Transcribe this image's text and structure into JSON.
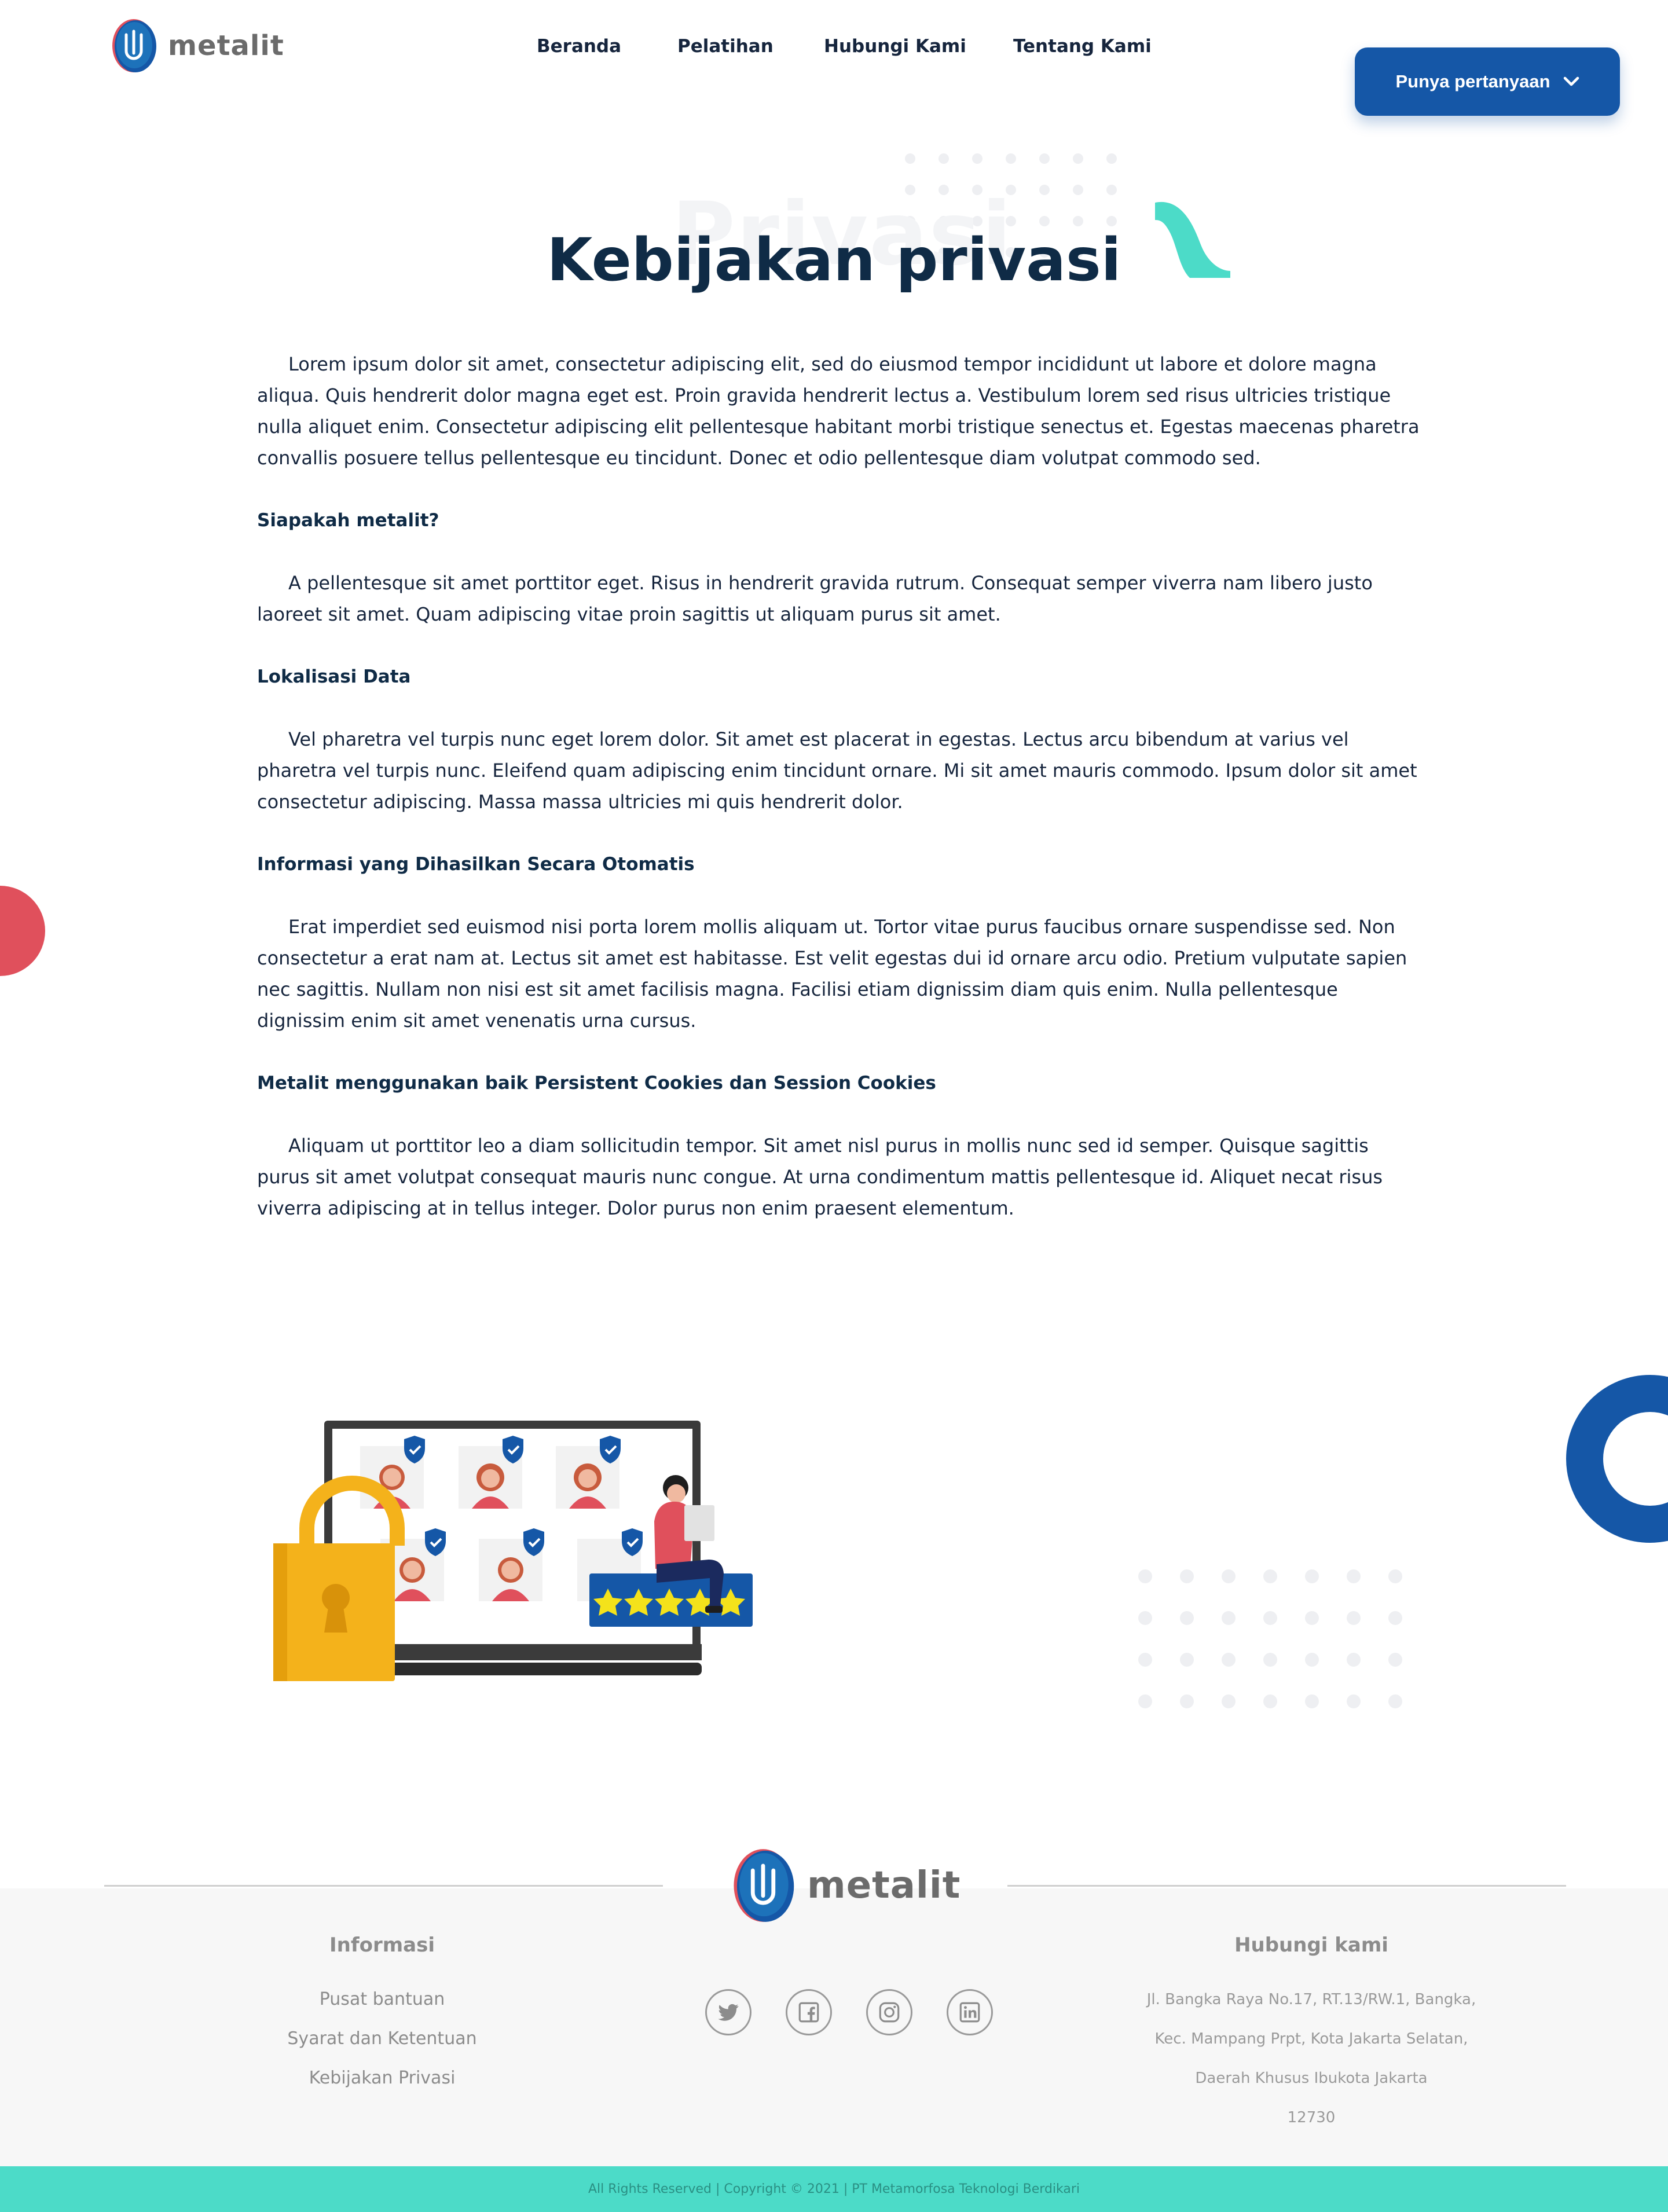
{
  "brand": {
    "name": "metalit"
  },
  "nav": {
    "items": [
      {
        "label": "Beranda"
      },
      {
        "label": "Pelatihan"
      },
      {
        "label": "Hubungi Kami"
      },
      {
        "label": "Tentang Kami"
      }
    ],
    "cta_label": "Punya pertanyaan",
    "cta_icon": "chevron-down-icon"
  },
  "hero": {
    "ghost_text": "Privasi",
    "title": "Kebijakan privasi"
  },
  "content": {
    "intro": "Lorem ipsum dolor sit amet, consectetur adipiscing elit, sed do eiusmod tempor incididunt ut labore et dolore magna aliqua. Quis hendrerit dolor magna eget est. Proin gravida hendrerit lectus a. Vestibulum lorem sed risus ultricies tristique nulla aliquet enim. Consectetur adipiscing elit pellentesque habitant morbi tristique senectus et. Egestas maecenas pharetra convallis posuere tellus pellentesque eu tincidunt. Donec et odio pellentesque diam volutpat commodo sed.",
    "sections": [
      {
        "heading": "Siapakah metalit?",
        "body": "A pellentesque sit amet porttitor eget. Risus in hendrerit gravida rutrum. Consequat semper viverra nam libero justo laoreet sit amet. Quam adipiscing vitae proin sagittis ut aliquam purus sit amet."
      },
      {
        "heading": "Lokalisasi Data",
        "body": "Vel pharetra vel turpis nunc eget lorem dolor. Sit amet est placerat in egestas. Lectus arcu bibendum at varius vel pharetra vel turpis nunc. Eleifend quam adipiscing enim  tincidunt ornare. Mi sit amet mauris commodo. Ipsum dolor sit amet consectetur adipiscing. Massa massa ultricies mi quis hendrerit dolor."
      },
      {
        "heading": "Informasi yang Dihasilkan Secara Otomatis",
        "body": "Erat imperdiet sed euismod nisi porta lorem mollis aliquam ut. Tortor vitae purus faucibus ornare suspendisse sed. Non consectetur a erat nam at. Lectus sit amet est habitasse. Est velit egestas dui id ornare arcu odio. Pretium vulputate sapien nec sagittis. Nullam non nisi est sit amet facilisis magna. Facilisi etiam dignissim diam quis enim. Nulla pellentesque dignissim enim sit amet venenatis urna cursus."
      },
      {
        "heading": "Metalit menggunakan baik Persistent Cookies dan Session Cookies",
        "body": "Aliquam ut porttitor leo a diam sollicitudin tempor. Sit amet nisl purus in mollis nunc sed id semper. Quisque sagittis purus sit amet volutpat consequat mauris nunc congue. At urna condimentum mattis pellentesque id. Aliquet necat risus viverra adipiscing at in tellus integer. Dolor purus non enim praesent elementum."
      }
    ]
  },
  "illustration": {
    "icon": "privacy-illustration",
    "rating_stars": 5
  },
  "footer": {
    "info": {
      "heading": "Informasi",
      "links": [
        "Pusat bantuan",
        "Syarat dan Ketentuan",
        "Kebijakan Privasi"
      ]
    },
    "socials": [
      "twitter-icon",
      "facebook-icon",
      "instagram-icon",
      "linkedin-icon"
    ],
    "contact": {
      "heading": "Hubungi kami",
      "address_lines": [
        "Jl. Bangka Raya No.17, RT.13/RW.1, Bangka,",
        "Kec. Mampang Prpt, Kota Jakarta Selatan,",
        "Daerah Khusus Ibukota Jakarta",
        "12730"
      ]
    },
    "copyright": "All Rights Reserved | Copyright © 2021 | PT Metamorfosa Teknologi Berdikari"
  },
  "colors": {
    "primary": "#1557a7",
    "navy": "#0f2b46",
    "teal": "#4cdbc8",
    "red": "#e0505c",
    "lock": "#f4b21b"
  }
}
